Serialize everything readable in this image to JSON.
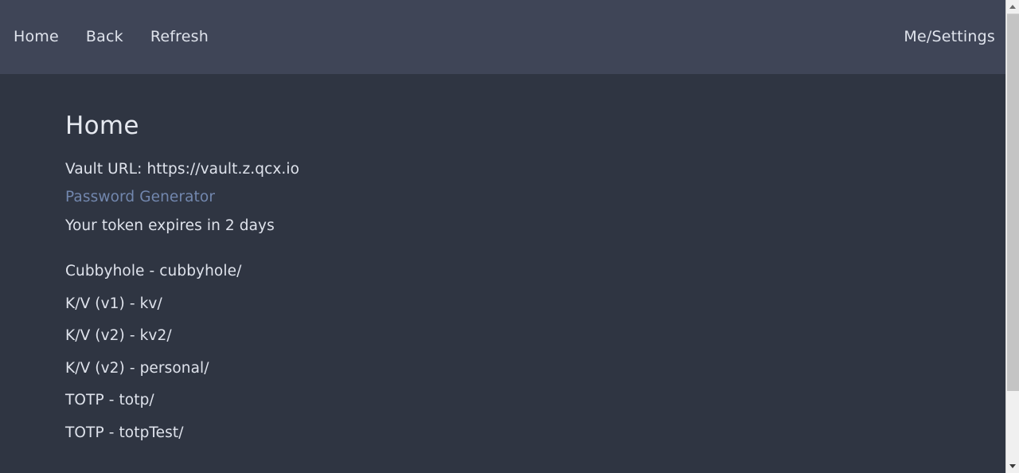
{
  "navbar": {
    "left_items": [
      {
        "label": "Home",
        "name": "nav-item-home"
      },
      {
        "label": "Back",
        "name": "nav-item-back"
      },
      {
        "label": "Refresh",
        "name": "nav-item-refresh"
      }
    ],
    "right_item": {
      "label": "Me/Settings",
      "name": "nav-item-me-settings"
    }
  },
  "page": {
    "title": "Home",
    "vault_url_line": "Vault URL: https://vault.z.qcx.io",
    "password_generator_link": "Password Generator",
    "token_expiry": "Your token expires in 2 days"
  },
  "mounts": [
    "Cubbyhole - cubbyhole/",
    "K/V (v1) - kv/",
    "K/V (v2) - kv2/",
    "K/V (v2) - personal/",
    "TOTP - totp/",
    "TOTP - totpTest/"
  ],
  "colors": {
    "navbar_bg": "#3f4557",
    "content_bg": "#2f3542",
    "text": "#dfe3ec",
    "link": "#7287ae",
    "scrollbar_track": "#f0f0f0",
    "scrollbar_thumb": "#c4c4c4"
  },
  "icons": {
    "scroll_up": "scroll-up-arrow-icon",
    "scroll_down": "scroll-down-arrow-icon"
  }
}
